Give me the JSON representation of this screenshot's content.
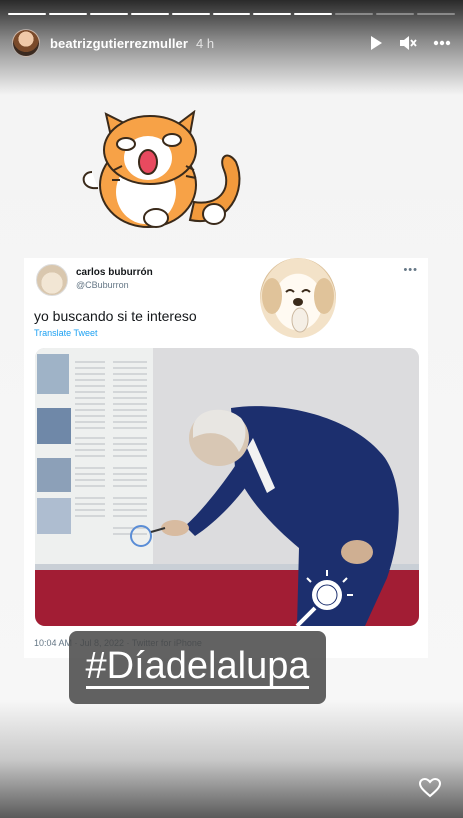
{
  "header": {
    "username": "beatrizgutierrezmuller",
    "time": "4 h",
    "icons": [
      "play-icon",
      "mute-icon",
      "more-icon"
    ]
  },
  "progress": {
    "segments": 11,
    "current": 8
  },
  "tweet": {
    "name": "carlos buburrón",
    "handle": "@CBuburron",
    "text": "yo buscando si te intereso",
    "translate": "Translate Tweet",
    "meta": "10:04 AM · Jul 8, 2022 · Twitter for iPhone",
    "more": "•••"
  },
  "sticker": {
    "hashtag": "#Díadelalupa"
  },
  "footer": {
    "icon": "heart-icon"
  }
}
